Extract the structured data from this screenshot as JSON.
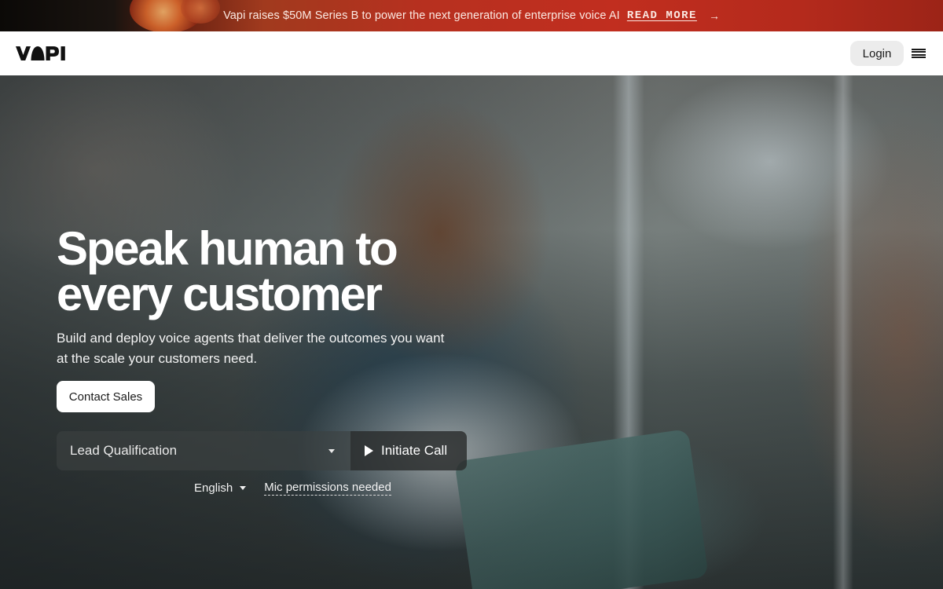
{
  "banner": {
    "text": "Vapi raises $50M Series B to power the next generation of enterprise voice AI",
    "link_label": "READ MORE",
    "arrow": "→"
  },
  "header": {
    "logo_text": "VAPI",
    "login_label": "Login",
    "menu_icon": "hamburger-menu-icon"
  },
  "hero": {
    "title_line1": "Speak human to",
    "title_line2": "every customer",
    "subtitle": "Build and deploy voice agents that deliver the outcomes you want at the scale your customers need.",
    "contact_label": "Contact Sales",
    "call": {
      "selected_scenario": "Lead Qualification",
      "initiate_label": "Initiate Call"
    },
    "language": "English",
    "mic_note": "Mic permissions needed"
  },
  "colors": {
    "banner_red": "#b7301f",
    "header_bg": "#ffffff",
    "login_bg": "#ececec",
    "hero_text": "#ffffff"
  }
}
